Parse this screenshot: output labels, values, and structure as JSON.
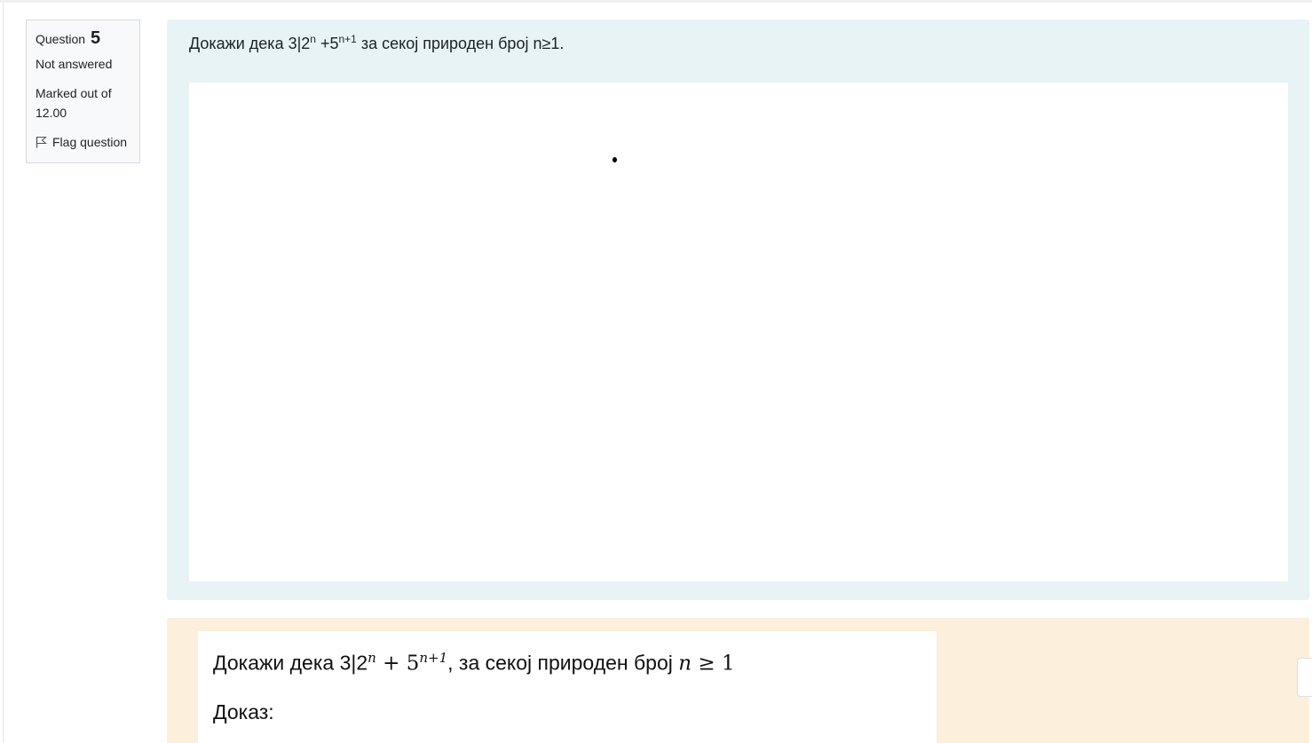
{
  "info": {
    "question_label": "Question",
    "question_number": "5",
    "state": "Not answered",
    "grade": "Marked out of 12.00",
    "flag_label": "Flag question"
  },
  "question": {
    "text_prefix": "Докажи дека 3|2",
    "exp1": "n",
    "text_mid": " +5",
    "exp2": "n+1",
    "text_suffix": " за секој природен број n≥1."
  },
  "feedback": {
    "prefix": "Докажи дека 3|2",
    "exp1": "n",
    "plus": " + 5",
    "exp2": "n+1",
    "mid": ", за секој природен број ",
    "var_n": "n",
    "relation": " ≥ 1",
    "proof_label": "Доказ:"
  },
  "icons": {
    "flag": "flag-outline-icon"
  }
}
